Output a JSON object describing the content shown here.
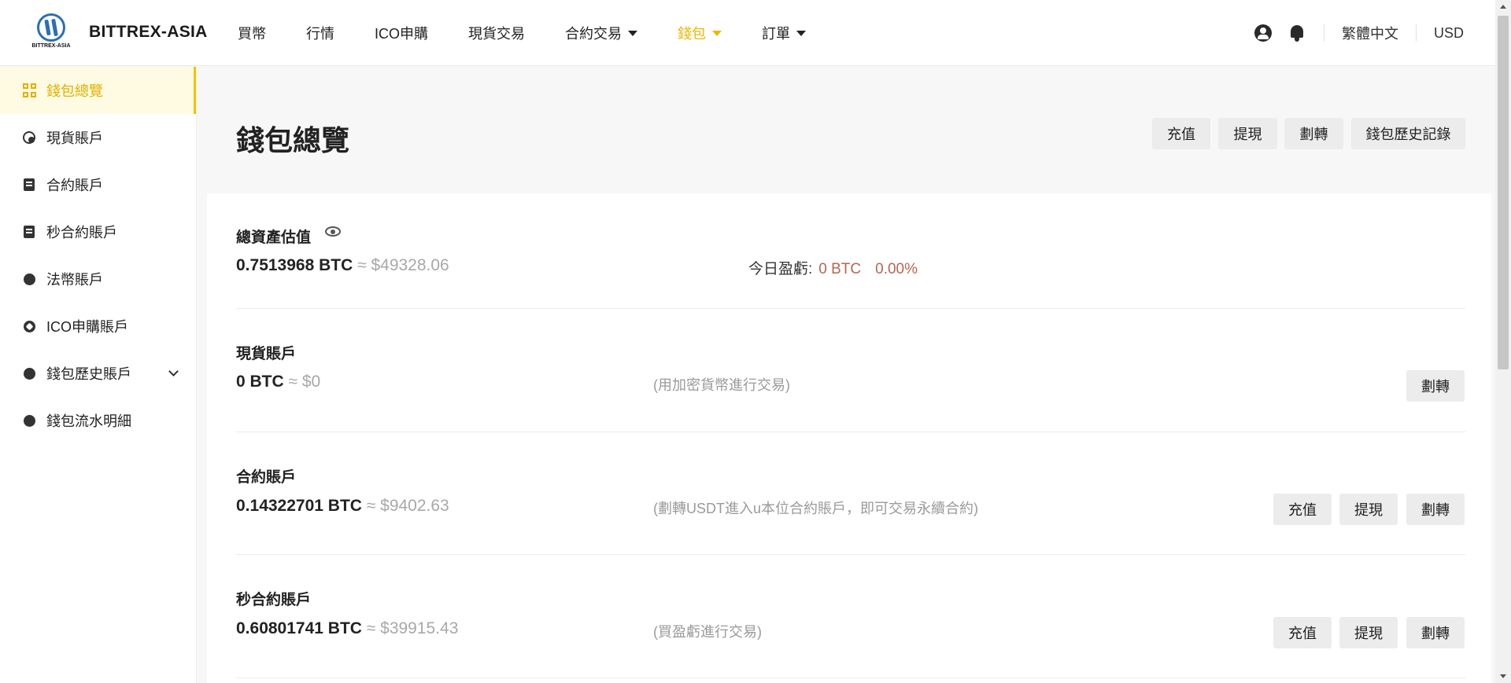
{
  "header": {
    "logo_caption": "BITTREX-ASIA",
    "brand": "BITTREX-ASIA",
    "nav": [
      {
        "label": "買幣"
      },
      {
        "label": "行情"
      },
      {
        "label": "ICO申購"
      },
      {
        "label": "現貨交易"
      },
      {
        "label": "合約交易"
      },
      {
        "label": "錢包"
      },
      {
        "label": "訂單"
      }
    ],
    "language": "繁體中文",
    "currency": "USD"
  },
  "sidebar": {
    "items": [
      {
        "label": "錢包總覽"
      },
      {
        "label": "現貨賬戶"
      },
      {
        "label": "合約賬戶"
      },
      {
        "label": "秒合約賬戶"
      },
      {
        "label": "法幣賬戶"
      },
      {
        "label": "ICO申購賬戶"
      },
      {
        "label": "錢包歷史賬戶"
      },
      {
        "label": "錢包流水明細"
      }
    ]
  },
  "main": {
    "title": "錢包總覽",
    "actions": {
      "deposit": "充值",
      "withdraw": "提現",
      "transfer": "劃轉",
      "history": "錢包歷史記錄"
    },
    "total": {
      "title": "總資產估值",
      "btc": "0.7513968 BTC",
      "approx": " ≈ $49328.06",
      "pnl_label": "今日盈虧:",
      "pnl_btc": "0 BTC",
      "pnl_pct": "0.00%"
    },
    "accounts": [
      {
        "title": "現貨賬戶",
        "btc": "0 BTC",
        "approx": " ≈ $0",
        "note": "(用加密貨幣進行交易)",
        "transfer": "劃轉"
      },
      {
        "title": "合約賬戶",
        "btc": "0.14322701 BTC",
        "approx": " ≈ $9402.63",
        "note": "(劃轉USDT進入u本位合約賬戶，即可交易永續合約)",
        "deposit": "充值",
        "withdraw": "提現",
        "transfer": "劃轉"
      },
      {
        "title": "秒合約賬戶",
        "btc": "0.60801741 BTC",
        "approx": " ≈ $39915.43",
        "note": "(買盈虧進行交易)",
        "deposit": "充值",
        "withdraw": "提現",
        "transfer": "劃轉"
      }
    ]
  }
}
